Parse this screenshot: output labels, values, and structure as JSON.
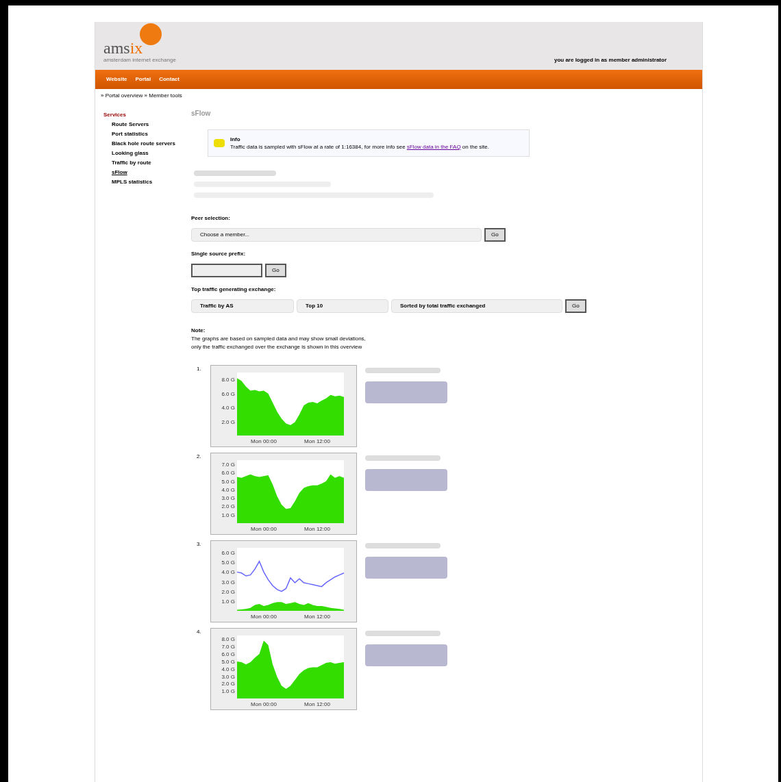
{
  "header": {
    "logo_word": "ams",
    "logo_accent": "ix",
    "logo_tagline": "amsterdam internet exchange",
    "user_line": "you are logged in as member administrator"
  },
  "nav": [
    "Website",
    "Portal",
    "Contact"
  ],
  "breadcrumb": "» Portal overview » Member tools",
  "sidebar": {
    "title": "Services",
    "items": [
      {
        "label": "Route Servers",
        "selected": false
      },
      {
        "label": "Port statistics",
        "selected": false
      },
      {
        "label": "Black hole route servers",
        "selected": false
      },
      {
        "label": "Looking glass",
        "selected": false
      },
      {
        "label": "Traffic by route",
        "selected": false
      },
      {
        "label": "sFlow",
        "selected": true
      },
      {
        "label": "MPLS statistics",
        "selected": false
      }
    ]
  },
  "page_title": "sFlow",
  "notice": {
    "title": "Info",
    "text": "Traffic data is sampled with sFlow at a rate of 1:16384, for more info see ",
    "link": "sFlow data in the FAQ",
    "after": " on the site."
  },
  "peer_section": {
    "label": "Peer selection:",
    "select_value": "Choose a member...",
    "button": "Go"
  },
  "prefix_section": {
    "label": "Single source prefix:",
    "button": "Go"
  },
  "traffic_section": {
    "label": "Top traffic generating exchange:",
    "selects": [
      "Traffic by AS",
      "Top 10",
      "Sorted by total traffic exchanged"
    ],
    "button": "Go"
  },
  "note": {
    "title": "Note:",
    "lines": [
      "The graphs are based on sampled data and may show small deviations,",
      "only the traffic exchanged over the exchange is shown in this overview"
    ]
  },
  "charts": [
    {
      "marker": "1.",
      "chart_data": {
        "type": "area",
        "ylim": [
          0,
          9
        ],
        "categories": [
          null,
          null,
          null,
          null,
          null,
          null,
          "Mon 00:00",
          null,
          null,
          null,
          null,
          null,
          null,
          null,
          null,
          null,
          null,
          null,
          "Mon 12:00",
          null,
          null,
          null,
          null,
          null,
          null
        ],
        "yticks": [
          {
            "value": 2,
            "label": "2.0 G"
          },
          {
            "value": 4,
            "label": "4.0 G"
          },
          {
            "value": 6,
            "label": "6.0 G"
          },
          {
            "value": 8,
            "label": "8.0 G"
          }
        ],
        "series": [
          {
            "color": "#33dd00",
            "values": [
              8.2,
              7.8,
              7.0,
              6.4,
              6.5,
              6.3,
              6.4,
              6.0,
              4.7,
              3.4,
              2.4,
              1.7,
              1.5,
              1.9,
              3.0,
              4.3,
              4.7,
              4.8,
              4.6,
              5.0,
              5.3,
              5.8,
              5.6,
              5.7,
              5.5
            ]
          }
        ]
      }
    },
    {
      "marker": "2.",
      "chart_data": {
        "type": "area",
        "ylim": [
          0,
          7.5
        ],
        "categories": [
          null,
          null,
          null,
          null,
          null,
          null,
          "Mon 00:00",
          null,
          null,
          null,
          null,
          null,
          null,
          null,
          null,
          null,
          null,
          null,
          "Mon 12:00",
          null,
          null,
          null,
          null,
          null,
          null
        ],
        "yticks": [
          {
            "value": 1,
            "label": "1.0 G"
          },
          {
            "value": 2,
            "label": "2.0 G"
          },
          {
            "value": 3,
            "label": "3.0 G"
          },
          {
            "value": 4,
            "label": "4.0 G"
          },
          {
            "value": 5,
            "label": "5.0 G"
          },
          {
            "value": 6,
            "label": "6.0 G"
          },
          {
            "value": 7,
            "label": "7.0 G"
          }
        ],
        "series": [
          {
            "color": "#33dd00",
            "values": [
              5.5,
              5.4,
              5.6,
              5.8,
              5.6,
              5.5,
              5.6,
              5.7,
              4.6,
              3.2,
              2.2,
              1.7,
              1.8,
              2.6,
              3.6,
              4.2,
              4.4,
              4.5,
              4.5,
              4.7,
              5.0,
              5.8,
              5.4,
              5.6,
              5.4
            ]
          }
        ]
      }
    },
    {
      "marker": "3.",
      "chart_data": {
        "type": "line",
        "ylim": [
          0,
          6.5
        ],
        "categories": [
          null,
          null,
          null,
          null,
          null,
          null,
          "Mon 00:00",
          null,
          null,
          null,
          null,
          null,
          null,
          null,
          null,
          null,
          null,
          null,
          "Mon 12:00",
          null,
          null,
          null,
          null,
          null,
          null
        ],
        "yticks": [
          {
            "value": 1,
            "label": "1.0 G"
          },
          {
            "value": 2,
            "label": "2.0 G"
          },
          {
            "value": 3,
            "label": "3.0 G"
          },
          {
            "value": 4,
            "label": "4.0 G"
          },
          {
            "value": 5,
            "label": "5.0 G"
          },
          {
            "value": 6,
            "label": "6.0 G"
          }
        ],
        "series": [
          {
            "color": "#6666ff",
            "values": [
              4.0,
              3.9,
              3.6,
              3.7,
              4.3,
              5.1,
              4.0,
              3.2,
              2.6,
              2.2,
              2.0,
              2.3,
              3.4,
              2.9,
              3.3,
              2.9,
              2.8,
              2.7,
              2.6,
              2.5,
              2.9,
              3.2,
              3.5,
              3.7,
              3.9
            ]
          },
          {
            "type": "area",
            "color": "#33dd00",
            "values": [
              0.1,
              0.15,
              0.2,
              0.3,
              0.6,
              0.7,
              0.5,
              0.6,
              0.8,
              0.9,
              0.9,
              0.7,
              0.8,
              0.9,
              0.7,
              0.6,
              0.8,
              0.6,
              0.5,
              0.5,
              0.4,
              0.3,
              0.25,
              0.2,
              0.1
            ]
          }
        ]
      }
    },
    {
      "marker": "4.",
      "chart_data": {
        "type": "area",
        "ylim": [
          0,
          8.5
        ],
        "categories": [
          null,
          null,
          null,
          null,
          null,
          null,
          "Mon 00:00",
          null,
          null,
          null,
          null,
          null,
          null,
          null,
          null,
          null,
          null,
          null,
          "Mon 12:00",
          null,
          null,
          null,
          null,
          null,
          null
        ],
        "yticks": [
          {
            "value": 1,
            "label": "1.0 G"
          },
          {
            "value": 2,
            "label": "2.0 G"
          },
          {
            "value": 3,
            "label": "3.0 G"
          },
          {
            "value": 4,
            "label": "4.0 G"
          },
          {
            "value": 5,
            "label": "5.0 G"
          },
          {
            "value": 6,
            "label": "6.0 G"
          },
          {
            "value": 7,
            "label": "7.0 G"
          },
          {
            "value": 8,
            "label": "8.0 G"
          }
        ],
        "series": [
          {
            "color": "#33dd00",
            "values": [
              5.0,
              4.9,
              4.6,
              4.9,
              5.5,
              6.0,
              7.8,
              7.2,
              4.6,
              2.9,
              1.7,
              1.3,
              1.7,
              2.5,
              3.3,
              3.8,
              4.1,
              4.2,
              4.2,
              4.5,
              4.8,
              4.9,
              4.7,
              4.8,
              4.9
            ]
          }
        ]
      }
    }
  ]
}
